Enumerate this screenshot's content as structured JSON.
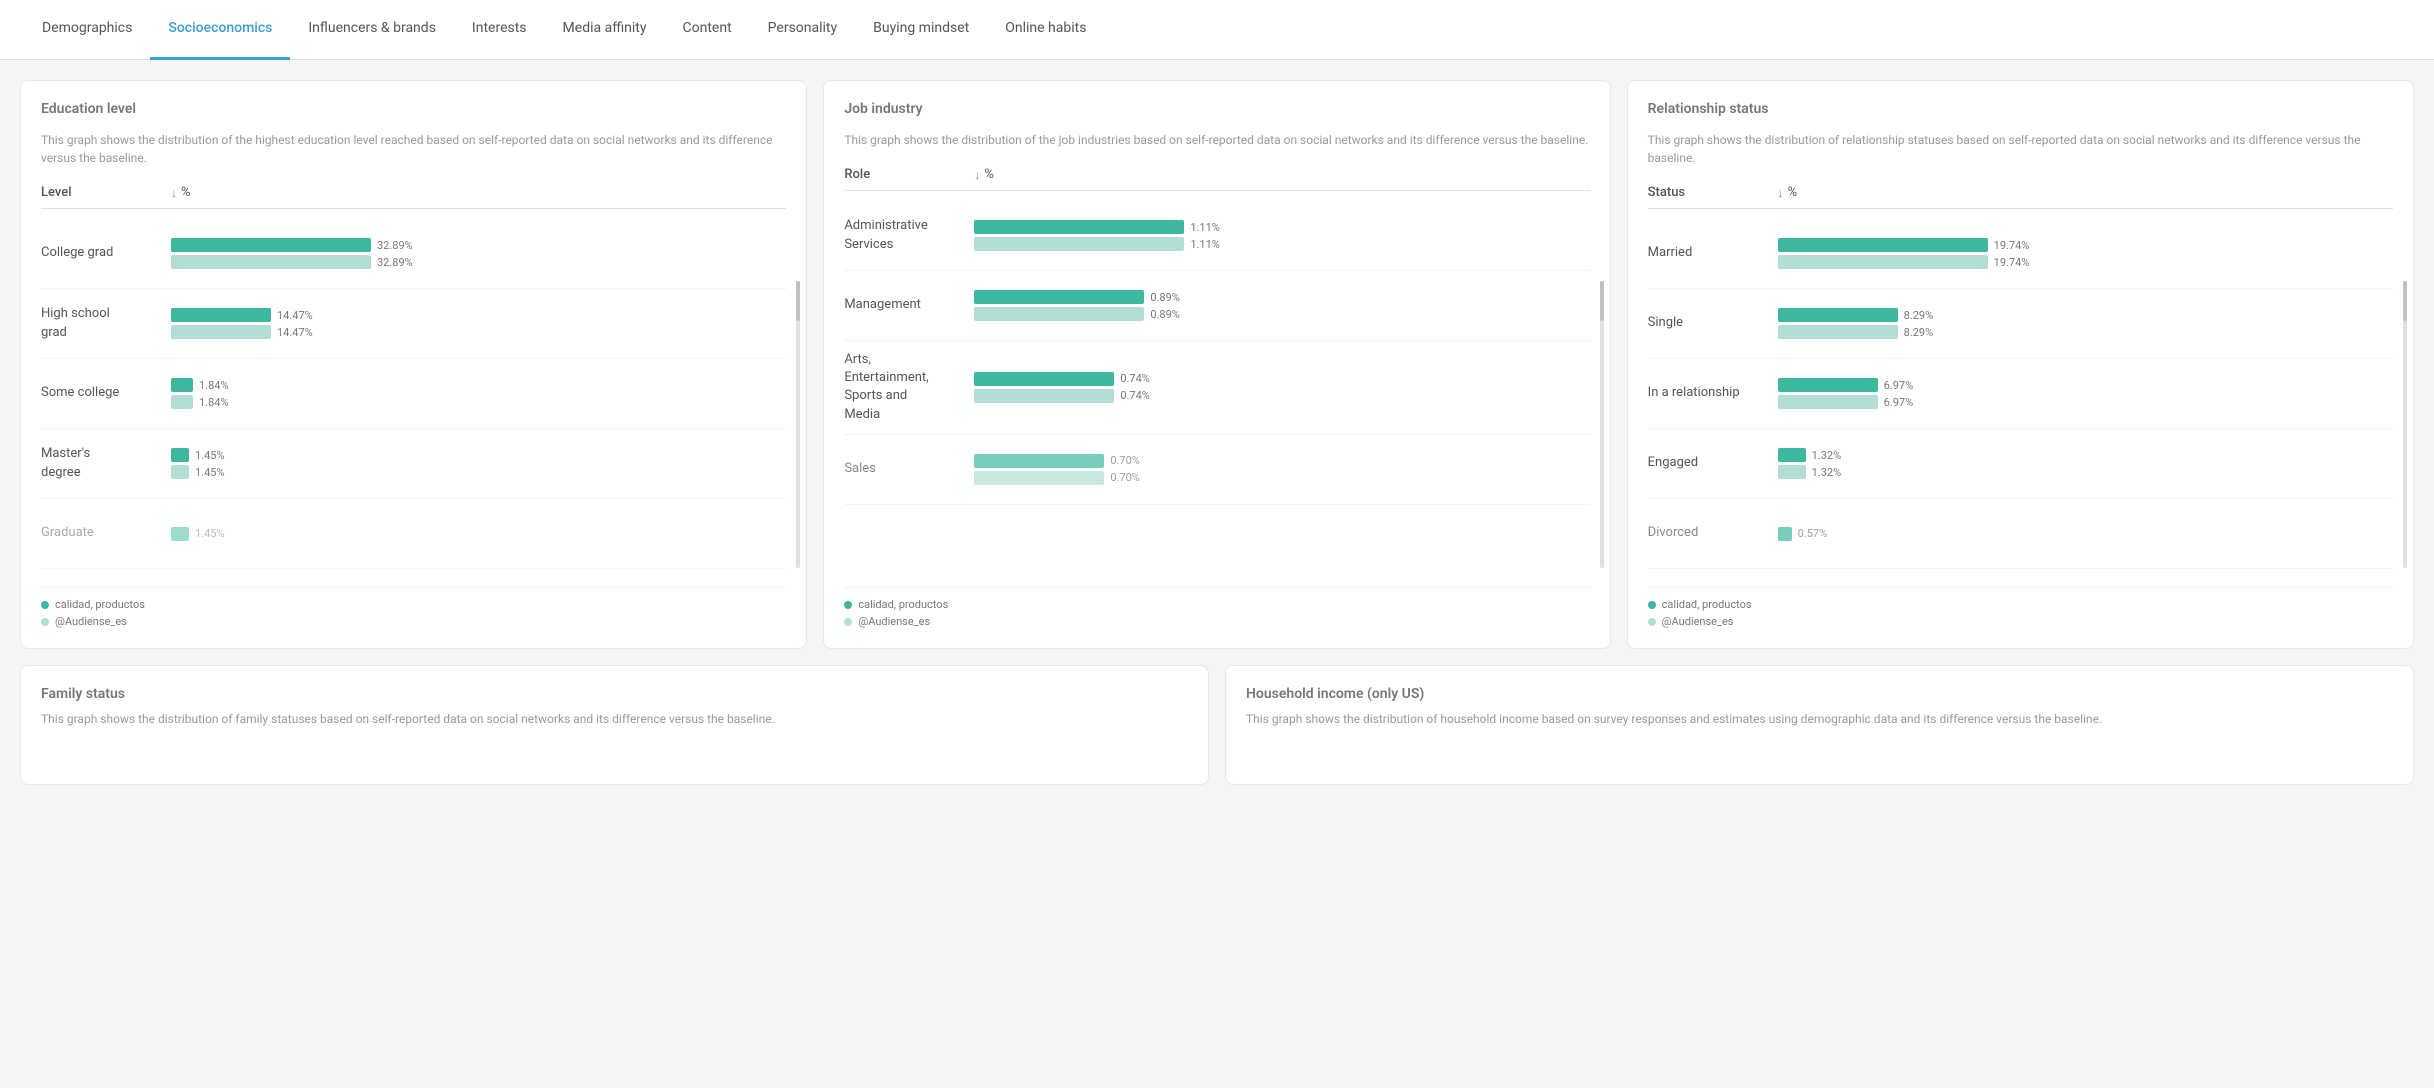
{
  "nav": {
    "items": [
      {
        "id": "demographics",
        "label": "Demographics",
        "active": false
      },
      {
        "id": "socioeconomics",
        "label": "Socioeconomics",
        "active": true
      },
      {
        "id": "influencers",
        "label": "Influencers & brands",
        "active": false
      },
      {
        "id": "interests",
        "label": "Interests",
        "active": false
      },
      {
        "id": "media-affinity",
        "label": "Media affinity",
        "active": false
      },
      {
        "id": "content",
        "label": "Content",
        "active": false
      },
      {
        "id": "personality",
        "label": "Personality",
        "active": false
      },
      {
        "id": "buying-mindset",
        "label": "Buying mindset",
        "active": false
      },
      {
        "id": "online-habits",
        "label": "Online habits",
        "active": false
      }
    ]
  },
  "cards": {
    "education": {
      "title": "Education level",
      "description": "This graph shows the distribution of the highest education level reached based on self-reported data on social networks and its difference versus the baseline.",
      "col_label": "Level",
      "col_sort": "%",
      "rows": [
        {
          "label": "College grad",
          "pct1": "32.89%",
          "pct2": "32.89%",
          "bar1_width": 200,
          "bar2_width": 200
        },
        {
          "label": "High school grad",
          "pct1": "14.47%",
          "pct2": "14.47%",
          "bar1_width": 100,
          "bar2_width": 100
        },
        {
          "label": "Some college",
          "pct1": "1.84%",
          "pct2": "1.84%",
          "bar1_width": 22,
          "bar2_width": 22
        },
        {
          "label": "Master's degree",
          "pct1": "1.45%",
          "pct2": "1.45%",
          "bar1_width": 18,
          "bar2_width": 18
        },
        {
          "label": "Graduate",
          "pct1": "1.45%",
          "pct2": "1.45%",
          "bar1_width": 18,
          "bar2_width": 18
        }
      ],
      "legend": [
        {
          "label": "calidad, productos",
          "type": "primary"
        },
        {
          "label": "@Audiense_es",
          "type": "secondary"
        }
      ]
    },
    "job": {
      "title": "Job industry",
      "description": "This graph shows the distribution of the job industries based on self-reported data on social networks and its difference versus the baseline.",
      "col_label": "Role",
      "col_sort": "%",
      "rows": [
        {
          "label": "Administrative Services",
          "pct1": "1.11%",
          "pct2": "1.11%",
          "bar1_width": 210,
          "bar2_width": 210
        },
        {
          "label": "Management",
          "pct1": "0.89%",
          "pct2": "0.89%",
          "bar1_width": 170,
          "bar2_width": 170
        },
        {
          "label": "Arts, Entertainment, Sports and Media",
          "pct1": "0.74%",
          "pct2": "0.74%",
          "bar1_width": 140,
          "bar2_width": 140
        },
        {
          "label": "Sales",
          "pct1": "0.70%",
          "pct2": "0.70%",
          "bar1_width": 130,
          "bar2_width": 130
        }
      ],
      "legend": [
        {
          "label": "calidad, productos",
          "type": "primary"
        },
        {
          "label": "@Audiense_es",
          "type": "secondary"
        }
      ]
    },
    "relationship": {
      "title": "Relationship status",
      "description": "This graph shows the distribution of relationship statuses based on self-reported data on social networks and its difference versus the baseline.",
      "col_label": "Status",
      "col_sort": "%",
      "rows": [
        {
          "label": "Married",
          "pct1": "19.74%",
          "pct2": "19.74%",
          "bar1_width": 210,
          "bar2_width": 210
        },
        {
          "label": "Single",
          "pct1": "8.29%",
          "pct2": "8.29%",
          "bar1_width": 120,
          "bar2_width": 120
        },
        {
          "label": "In a relationship",
          "pct1": "6.97%",
          "pct2": "6.97%",
          "bar1_width": 100,
          "bar2_width": 100
        },
        {
          "label": "Engaged",
          "pct1": "1.32%",
          "pct2": "1.32%",
          "bar1_width": 28,
          "bar2_width": 28
        },
        {
          "label": "Divorced",
          "pct1": "0.57%",
          "pct2": "0.57%",
          "bar1_width": 14,
          "bar2_width": 14
        }
      ],
      "legend": [
        {
          "label": "calidad, productos",
          "type": "primary"
        },
        {
          "label": "@Audiense_es",
          "type": "secondary"
        }
      ]
    }
  },
  "bottom_cards": {
    "family": {
      "title": "Family status",
      "description": "This graph shows the distribution of family statuses based on self-reported data on social networks and its difference versus the baseline."
    },
    "household": {
      "title": "Household income (only US)",
      "description": "This graph shows the distribution of household income based on survey responses and estimates using demographic data and its difference versus the baseline."
    }
  }
}
